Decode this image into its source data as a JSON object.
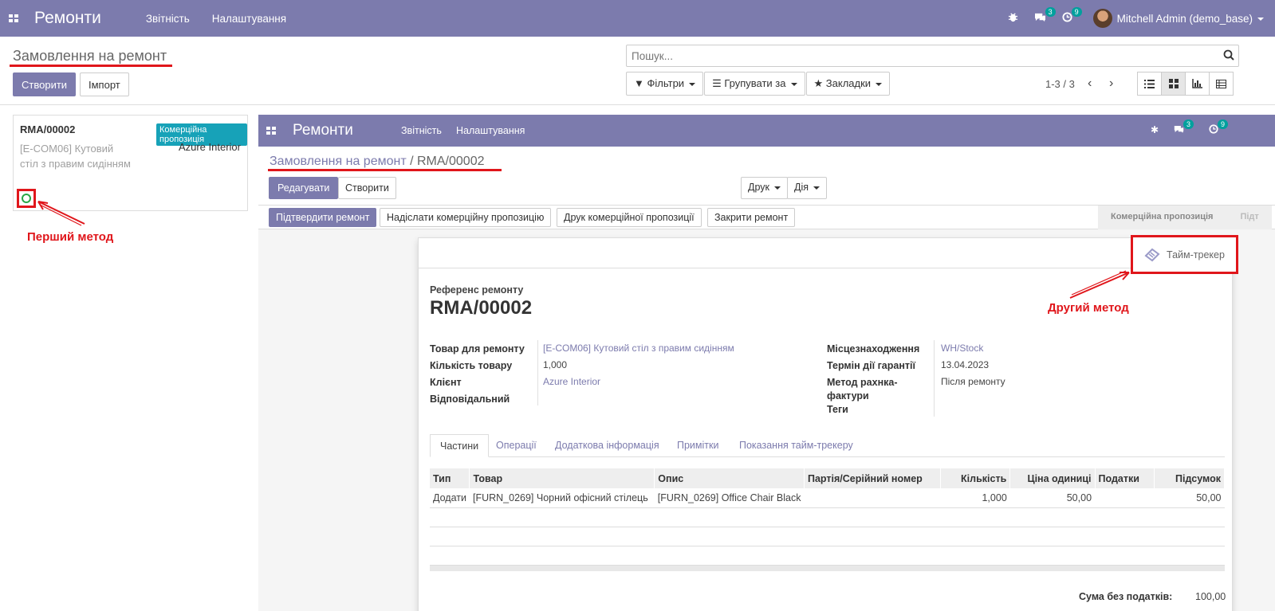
{
  "topnav": {
    "app_name": "Ремонти",
    "menu": [
      "Звітність",
      "Налаштування"
    ],
    "chat_count": "3",
    "activity_count": "9",
    "user": "Mitchell Admin (demo_base)"
  },
  "control_panel": {
    "breadcrumb": "Замовлення на ремонт",
    "create": "Створити",
    "import": "Імпорт",
    "search_placeholder": "Пошук...",
    "filters": "Фільтри",
    "group_by": "Групувати за",
    "favorites": "Закладки",
    "pager": "1-3 / 3"
  },
  "kanban_card": {
    "ref": "RMA/00002",
    "state": "Комерційна пропозиція",
    "product": "[E-COM06] Кутовий стіл з правим сидінням",
    "partner": "Azure Interior"
  },
  "annotations": {
    "first_method": "Перший метод",
    "second_method": "Другий метод"
  },
  "form": {
    "breadcrumb_parent": "Замовлення на ремонт",
    "breadcrumb_sep": " / ",
    "breadcrumb_current": "RMA/00002",
    "edit": "Редагувати",
    "create": "Створити",
    "print": "Друк",
    "action": "Дія",
    "status_buttons": [
      "Підтвердити ремонт",
      "Надіслати комерційну пропозицію",
      "Друк комерційної пропозиції",
      "Закрити ремонт"
    ],
    "stage_current": "Комерційна пропозиція",
    "stage_next": "Підт",
    "timer_button": "Тайм-трекер",
    "ref_label": "Референс ремонту",
    "ref": "RMA/00002",
    "left_fields": [
      {
        "label": "Товар для ремонту",
        "value": "[E-COM06] Кутовий стіл з правим сидінням",
        "link": true
      },
      {
        "label": "Кількість товару",
        "value": "1,000",
        "link": false
      },
      {
        "label": "Клієнт",
        "value": "Azure Interior",
        "link": true
      },
      {
        "label": "Відповідальний",
        "value": "",
        "link": false
      }
    ],
    "right_fields": [
      {
        "label": "Місцезнаходження",
        "value": "WH/Stock",
        "link": true
      },
      {
        "label": "Термін дії гарантії",
        "value": "13.04.2023",
        "link": false
      },
      {
        "label": "Метод рахнка-фактури",
        "value": "Після ремонту",
        "link": false
      },
      {
        "label": "Теги",
        "value": "",
        "link": false
      }
    ],
    "tabs": [
      "Частини",
      "Операції",
      "Додаткова інформація",
      "Примітки",
      "Показання тайм-трекеру"
    ],
    "columns": [
      "Тип",
      "Товар",
      "Опис",
      "Партія/Серійний номер",
      "Кількість",
      "Ціна одиниці",
      "Податки",
      "Підсумок"
    ],
    "rows": [
      [
        "Додати",
        "[FURN_0269] Чорний офісний стілець",
        "[FURN_0269] Office Chair Black",
        "",
        "1,000",
        "50,00",
        "",
        "50,00"
      ]
    ],
    "total_label": "Сума без податків:",
    "total_value": "100,00"
  },
  "colors": {
    "brand": "#7c7bad",
    "highlight": "#e0161b",
    "badge": "#17a2b8"
  }
}
